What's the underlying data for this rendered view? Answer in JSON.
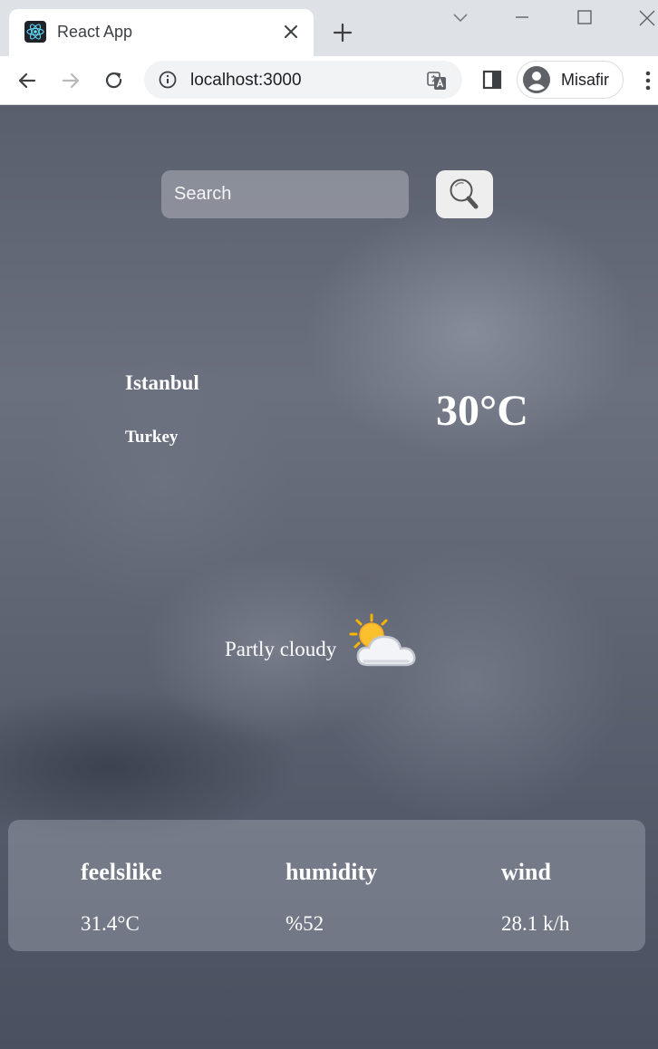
{
  "browser": {
    "tab_title": "React App",
    "url": "localhost:3000",
    "profile_name": "Misafir"
  },
  "search": {
    "placeholder": "Search"
  },
  "location": {
    "city": "Istanbul",
    "country": "Turkey"
  },
  "current": {
    "temperature": "30°C",
    "condition": "Partly cloudy",
    "condition_icon": "partly-cloudy-icon"
  },
  "details": {
    "feelslike_label": "feelslike",
    "feelslike_value": "31.4°C",
    "humidity_label": "humidity",
    "humidity_value": "%52",
    "wind_label": "wind",
    "wind_value": "28.1 k/h"
  }
}
